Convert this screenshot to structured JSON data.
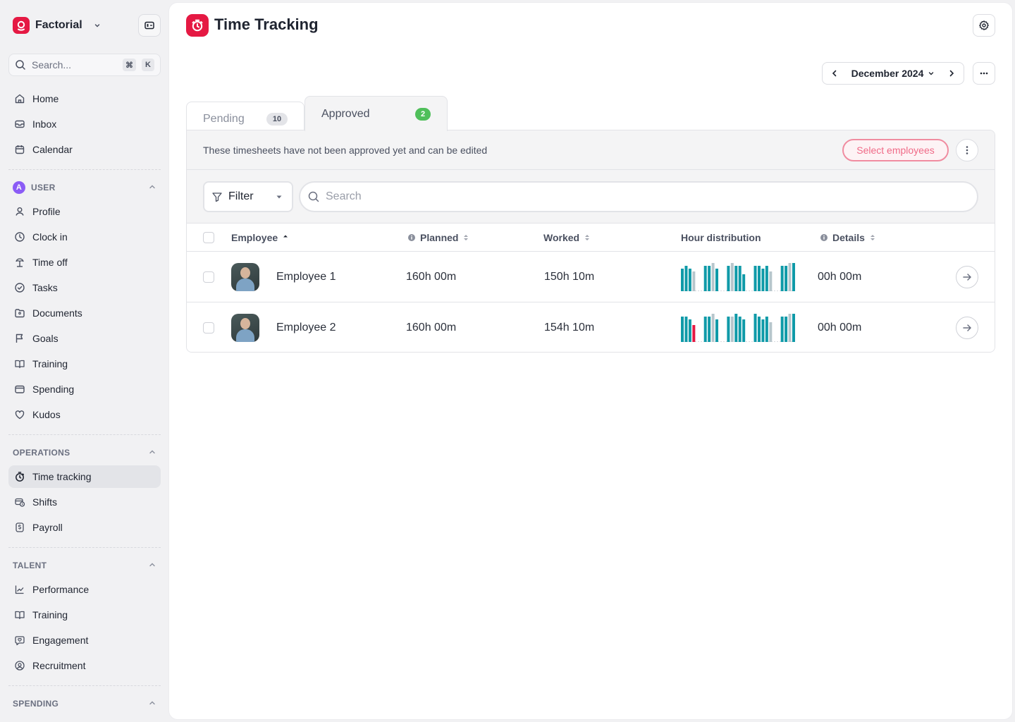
{
  "sidebar": {
    "brand": "Factorial",
    "search": {
      "placeholder": "Search...",
      "kbd_cmd": "⌘",
      "kbd_key": "K"
    },
    "top_items": [
      {
        "label": "Home",
        "icon": "home-icon"
      },
      {
        "label": "Inbox",
        "icon": "inbox-icon"
      },
      {
        "label": "Calendar",
        "icon": "calendar-icon"
      }
    ],
    "user_section": {
      "avatar_letter": "A",
      "title": "USER",
      "items": [
        {
          "label": "Profile",
          "icon": "person-icon"
        },
        {
          "label": "Clock in",
          "icon": "clock-icon"
        },
        {
          "label": "Time off",
          "icon": "island-icon"
        },
        {
          "label": "Tasks",
          "icon": "check-circle-icon"
        },
        {
          "label": "Documents",
          "icon": "folder-icon"
        },
        {
          "label": "Goals",
          "icon": "flag-icon"
        },
        {
          "label": "Training",
          "icon": "book-icon"
        },
        {
          "label": "Spending",
          "icon": "wallet-icon"
        },
        {
          "label": "Kudos",
          "icon": "heart-icon"
        }
      ]
    },
    "operations_section": {
      "title": "OPERATIONS",
      "items": [
        {
          "label": "Time tracking",
          "icon": "stopwatch-icon",
          "active": true
        },
        {
          "label": "Shifts",
          "icon": "shifts-icon"
        },
        {
          "label": "Payroll",
          "icon": "payroll-icon"
        }
      ]
    },
    "talent_section": {
      "title": "TALENT",
      "items": [
        {
          "label": "Performance",
          "icon": "chart-line-icon"
        },
        {
          "label": "Training",
          "icon": "book-icon"
        },
        {
          "label": "Engagement",
          "icon": "chat-heart-icon"
        },
        {
          "label": "Recruitment",
          "icon": "user-search-icon"
        }
      ]
    },
    "spending_section": {
      "title": "SPENDING"
    }
  },
  "header": {
    "title": "Time Tracking",
    "date_label": "December 2024"
  },
  "tabs": [
    {
      "label": "Pending",
      "count": "10"
    },
    {
      "label": "Approved",
      "count": "2"
    }
  ],
  "notice": {
    "text": "These timesheets have not been approved yet and can be edited",
    "select_button": "Select employees"
  },
  "filters": {
    "filter_label": "Filter",
    "search_placeholder": "Search"
  },
  "table": {
    "columns": {
      "employee": "Employee",
      "planned": "Planned",
      "worked": "Worked",
      "distribution": "Hour distribution",
      "details": "Details"
    },
    "rows": [
      {
        "name": "Employee 1",
        "planned": "160h 00m",
        "worked": "150h 10m",
        "details": "00h 00m",
        "bars": [
          8,
          9,
          8,
          7,
          0,
          0,
          9,
          9,
          10,
          8,
          0,
          0,
          9,
          10,
          9,
          9,
          6,
          0,
          0,
          9,
          9,
          8,
          9,
          7,
          0,
          0,
          9,
          9,
          10,
          10
        ],
        "highlight": [
          4
        ],
        "highlight_color": "#f08ca0"
      },
      {
        "name": "Employee 2",
        "planned": "160h 00m",
        "worked": "154h 10m",
        "details": "00h 00m",
        "bars": [
          9,
          9,
          8,
          6,
          0,
          0,
          9,
          9,
          10,
          8,
          0,
          0,
          9,
          9,
          10,
          9,
          8,
          0,
          0,
          10,
          9,
          8,
          9,
          7,
          0,
          0,
          9,
          9,
          10,
          10
        ],
        "highlight": [
          3
        ],
        "highlight_color": "#e51943"
      }
    ]
  },
  "colors": {
    "brand": "#e51943",
    "bar": "#0f9aa8",
    "bar_light": "#b7c6cc",
    "badge_green": "#4fbf5a"
  }
}
